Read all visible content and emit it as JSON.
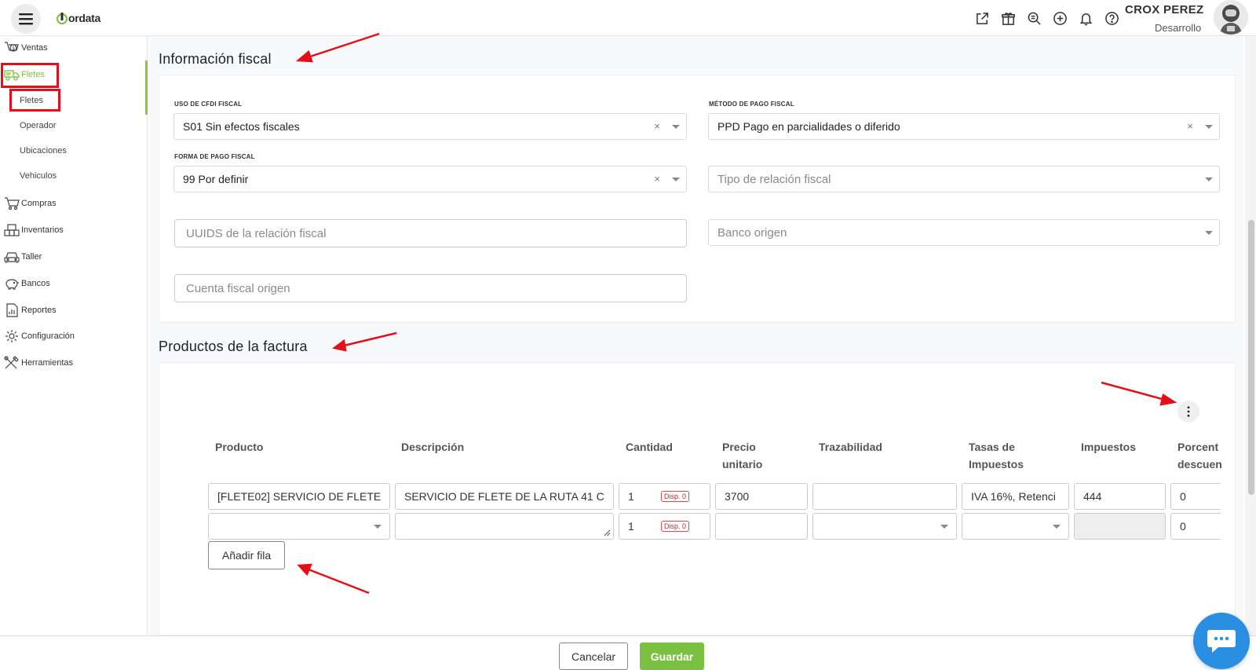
{
  "header": {
    "brand": "ordata",
    "user_name": "CROX PEREZ",
    "user_role": "Desarrollo",
    "icons": [
      "external-link-icon",
      "gift-icon",
      "search-zoom-icon",
      "plus-circle-icon",
      "bell-icon",
      "help-icon"
    ]
  },
  "sidebar": {
    "items": [
      {
        "label": "Ventas",
        "icon": "sales-icon"
      },
      {
        "label": "Fletes",
        "icon": "truck-icon"
      },
      {
        "label": "Compras",
        "icon": "cart-icon"
      },
      {
        "label": "Inventarios",
        "icon": "warehouse-icon"
      },
      {
        "label": "Taller",
        "icon": "car-icon"
      },
      {
        "label": "Bancos",
        "icon": "piggy-bank-icon"
      },
      {
        "label": "Reportes",
        "icon": "report-icon"
      },
      {
        "label": "Configuración",
        "icon": "gear-icon"
      },
      {
        "label": "Herramientas",
        "icon": "tools-icon"
      }
    ],
    "sub_items": [
      "Fletes",
      "Operador",
      "Ubicaciones",
      "Vehiculos"
    ]
  },
  "fiscal": {
    "title": "Información fiscal",
    "uso_cfdi_label": "USO DE CFDI FISCAL",
    "uso_cfdi_value": "S01 Sin efectos fiscales",
    "metodo_pago_label": "MÉTODO DE PAGO FISCAL",
    "metodo_pago_value": "PPD Pago en parcialidades o diferido",
    "forma_pago_label": "FORMA DE PAGO FISCAL",
    "forma_pago_value": "99 Por definir",
    "tipo_relacion_placeholder": "Tipo de relación fiscal",
    "uuids_placeholder": "UUIDS de la relación fiscal",
    "banco_origen_placeholder": "Banco origen",
    "cuenta_origen_placeholder": "Cuenta fiscal origen",
    "clear_symbol": "×"
  },
  "products": {
    "title": "Productos de la factura",
    "columns": [
      "Producto",
      "Descripción",
      "Cantidad",
      "Precio unitario",
      "Trazabilidad",
      "Tasas de Impuestos",
      "Impuestos",
      "Porcent descuen"
    ],
    "rows": [
      {
        "producto": "[FLETE02] SERVICIO DE FLETE",
        "descripcion": "SERVICIO DE FLETE DE LA RUTA 41 C",
        "cantidad": "1",
        "disp": "Disp. 0",
        "precio": "3700",
        "trazabilidad": "",
        "tasas": "IVA 16%, Retenci",
        "impuestos": "444",
        "descuento": "0"
      },
      {
        "producto": "",
        "descripcion": "",
        "cantidad": "1",
        "disp": "Disp. 0",
        "precio": "",
        "trazabilidad": "",
        "tasas": "",
        "impuestos": "",
        "descuento": "0"
      }
    ],
    "add_row_label": "Añadir fila"
  },
  "footer": {
    "cancel_label": "Cancelar",
    "save_label": "Guardar"
  },
  "colors": {
    "accent_green": "#7ac142",
    "annotation_red": "#e3101a",
    "chat_blue": "#2a8fe0"
  }
}
